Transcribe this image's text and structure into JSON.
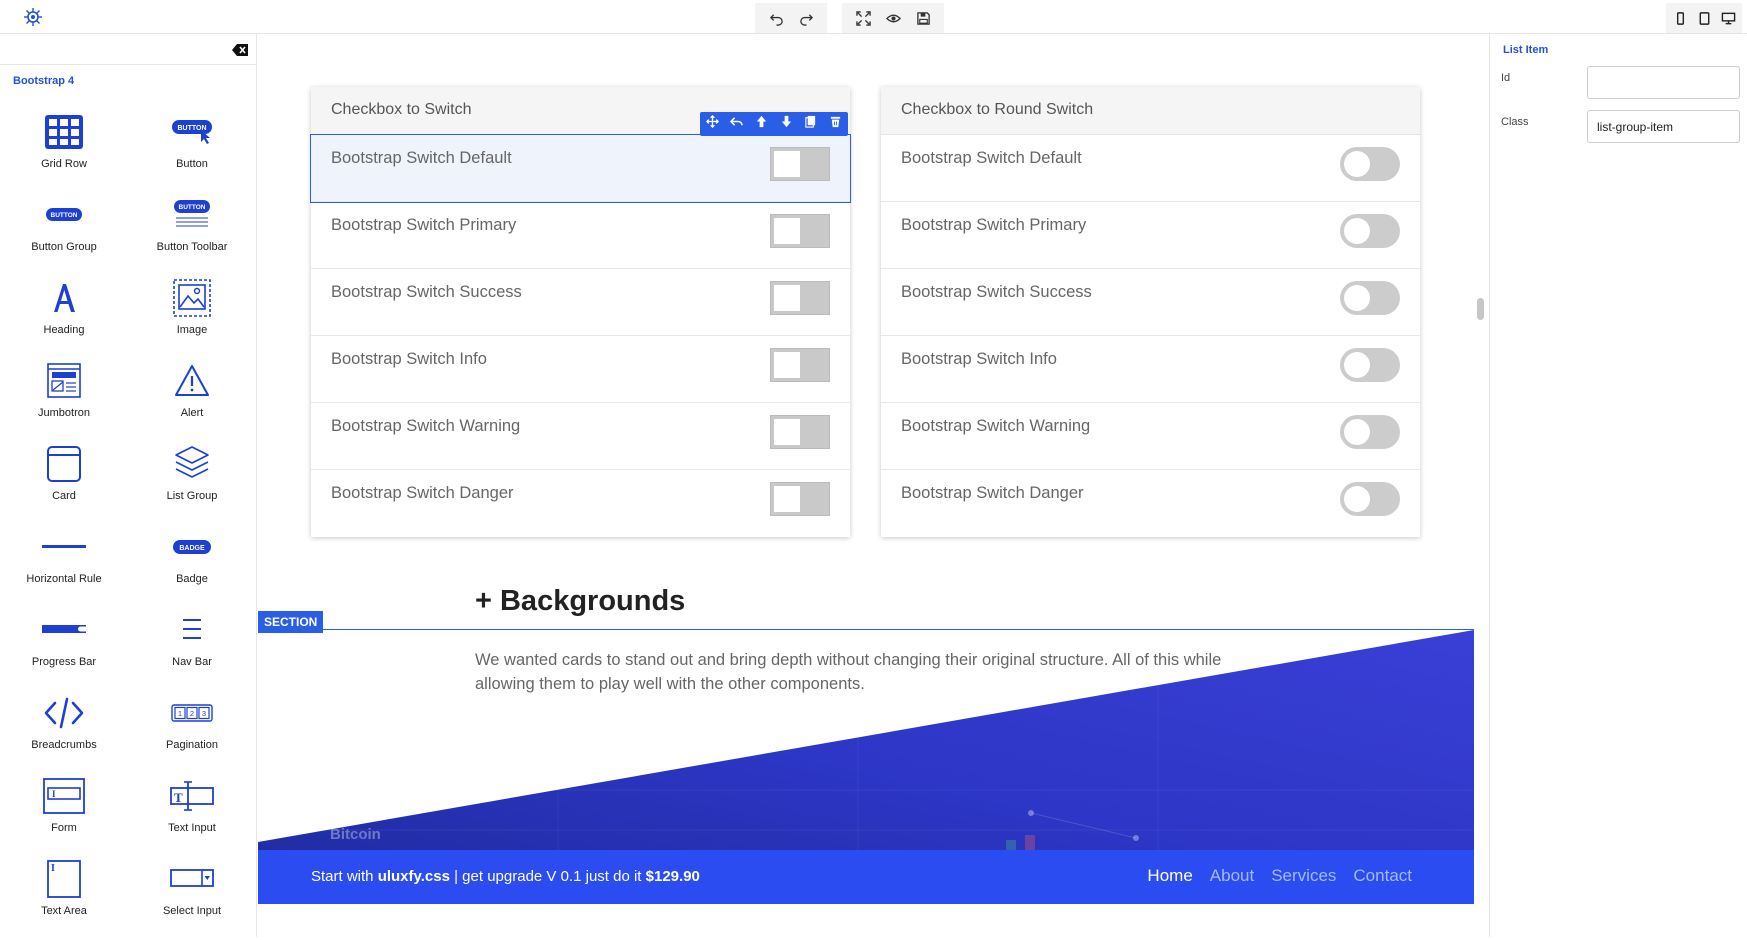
{
  "topbar": {
    "icons": [
      "logo-icon",
      "undo-icon",
      "redo-icon",
      "fullscreen-icon",
      "preview-eye-icon",
      "save-icon",
      "mobile-view-icon",
      "tablet-view-icon",
      "desktop-view-icon"
    ]
  },
  "sidebar": {
    "title": "Bootstrap 4",
    "components": [
      {
        "label": "Grid Row",
        "icon": "grid-row-icon"
      },
      {
        "label": "Button",
        "icon": "button-icon"
      },
      {
        "label": "Button Group",
        "icon": "button-group-icon"
      },
      {
        "label": "Button Toolbar",
        "icon": "button-toolbar-icon"
      },
      {
        "label": "Heading",
        "icon": "heading-icon"
      },
      {
        "label": "Image",
        "icon": "image-icon"
      },
      {
        "label": "Jumbotron",
        "icon": "jumbotron-icon"
      },
      {
        "label": "Alert",
        "icon": "alert-icon"
      },
      {
        "label": "Card",
        "icon": "card-icon"
      },
      {
        "label": "List Group",
        "icon": "list-group-icon"
      },
      {
        "label": "Horizontal Rule",
        "icon": "horizontal-rule-icon"
      },
      {
        "label": "Badge",
        "icon": "badge-icon"
      },
      {
        "label": "Progress Bar",
        "icon": "progress-bar-icon"
      },
      {
        "label": "Nav Bar",
        "icon": "nav-bar-icon"
      },
      {
        "label": "Breadcrumbs",
        "icon": "breadcrumbs-icon"
      },
      {
        "label": "Pagination",
        "icon": "pagination-icon"
      },
      {
        "label": "Form",
        "icon": "form-icon"
      },
      {
        "label": "Text Input",
        "icon": "text-input-icon"
      },
      {
        "label": "Text Area",
        "icon": "text-area-icon"
      },
      {
        "label": "Select Input",
        "icon": "select-input-icon"
      }
    ],
    "icon_texts": {
      "button": "BUTTON",
      "badge": "BADGE",
      "pagination": [
        "1",
        "2",
        "3"
      ],
      "text_input": "T",
      "form": "I",
      "text_area": "I"
    }
  },
  "canvas": {
    "card_left": {
      "header": "Checkbox to Switch",
      "items": [
        "Bootstrap Switch Default",
        "Bootstrap Switch Primary",
        "Bootstrap Switch Success",
        "Bootstrap Switch Info",
        "Bootstrap Switch Warning",
        "Bootstrap Switch Danger"
      ]
    },
    "card_right": {
      "header": "Checkbox to Round Switch",
      "items": [
        "Bootstrap Switch Default",
        "Bootstrap Switch Primary",
        "Bootstrap Switch Success",
        "Bootstrap Switch Info",
        "Bootstrap Switch Warning",
        "Bootstrap Switch Danger"
      ]
    },
    "element_toolbar_icons": [
      "move-icon",
      "select-parent-icon",
      "move-up-icon",
      "move-down-icon",
      "clone-icon",
      "delete-icon"
    ],
    "backgrounds_heading": "+ Backgrounds",
    "section_tag": "SECTION",
    "section_text": "We wanted cards to stand out and bring depth without changing their original structure. All of this while allowing them to play well with the other components.",
    "bitcoin_label": "Bitcoin",
    "footer": {
      "prefix": "Start with ",
      "brand": "uluxfy.css",
      "middle": " | get upgrade V 0.1 just do it ",
      "price": "$129.90",
      "nav": [
        "Home",
        "About",
        "Services",
        "Contact"
      ]
    }
  },
  "right_panel": {
    "title": "List Item",
    "id_label": "Id",
    "id_value": "",
    "class_label": "Class",
    "class_value": "list-group-item"
  },
  "colors": {
    "accent": "#2b5ee6",
    "footer": "#2b4cf0",
    "section_gradient": [
      "#2a37c9",
      "#3a3fd6"
    ]
  }
}
